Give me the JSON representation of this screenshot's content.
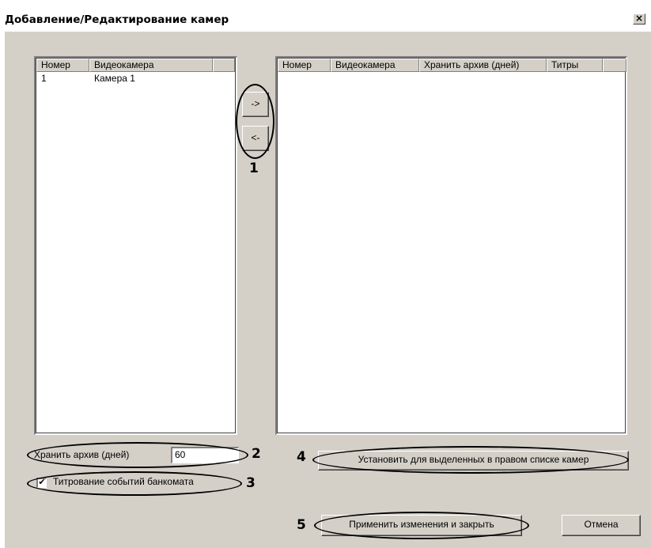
{
  "window": {
    "title": "Добавление/Редактирование камер",
    "close_label": "×"
  },
  "left_list": {
    "columns": [
      "Номер",
      "Видеокамера"
    ],
    "rows": [
      [
        "1",
        "Камера 1"
      ]
    ]
  },
  "right_list": {
    "columns": [
      "Номер",
      "Видеокамера",
      "Хранить архив (дней)",
      "Титры"
    ],
    "rows": []
  },
  "transfer": {
    "add_label": "->",
    "remove_label": "<-"
  },
  "archive": {
    "label": "Хранить архив (дней)",
    "value": "60"
  },
  "atm_titles": {
    "label": "Титрование событий банкомата",
    "checked": true,
    "mark": "✔"
  },
  "buttons": {
    "apply_selected": "Установить для выделенных в правом списке камер",
    "apply_close": "Применить изменения и закрыть",
    "cancel": "Отмена"
  },
  "callouts": [
    "1",
    "2",
    "3",
    "4",
    "5"
  ]
}
